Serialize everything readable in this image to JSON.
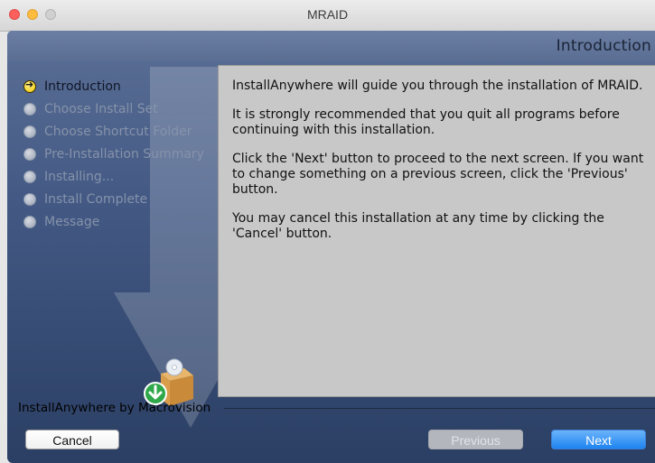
{
  "window": {
    "title": "MRAID"
  },
  "header": {
    "title": "Introduction"
  },
  "steps": [
    {
      "label": "Introduction",
      "active": true
    },
    {
      "label": "Choose Install Set",
      "active": false
    },
    {
      "label": "Choose Shortcut Folder",
      "active": false
    },
    {
      "label": "Pre-Installation Summary",
      "active": false
    },
    {
      "label": "Installing...",
      "active": false
    },
    {
      "label": "Install Complete",
      "active": false
    },
    {
      "label": "Message",
      "active": false
    }
  ],
  "content": {
    "paragraphs": [
      "InstallAnywhere will guide you through the installation of MRAID.",
      "It is strongly recommended that you quit all programs before continuing with this installation.",
      "Click the 'Next' button to proceed to the next screen. If you want to change something on a previous screen, click the 'Previous' button.",
      "You may cancel this installation at any time by clicking the 'Cancel' button."
    ]
  },
  "footer": {
    "vendor": "InstallAnywhere by Macrovision"
  },
  "buttons": {
    "cancel": "Cancel",
    "previous": "Previous",
    "next": "Next"
  },
  "icons": {
    "installer": "installer-box-icon",
    "arrow": "arrow-right-icon"
  }
}
